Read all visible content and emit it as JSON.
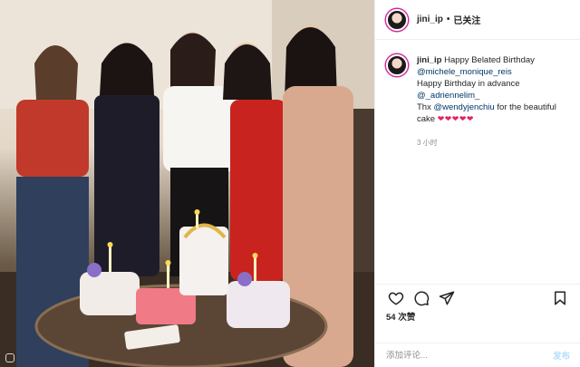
{
  "post": {
    "username": "jini_ip",
    "separator": "•",
    "follow_label": "已关注",
    "caption": {
      "username": "jini_ip",
      "text1": "Happy Belated Birthday",
      "mention1": "@michele_monique_reis",
      "text2": "Happy Birthday in advance",
      "mention2": "@_adriennelim_",
      "text3": "Thx",
      "mention3": "@wendyjenchiu",
      "text4": "for the beautiful cake",
      "hearts": "❤❤❤❤❤"
    },
    "time": "3 小时",
    "likes": "54 次赞",
    "comment_placeholder": "添加评论...",
    "post_label": "发布"
  },
  "icons": {
    "like": "heart-icon",
    "comment": "comment-icon",
    "share": "share-icon",
    "save": "bookmark-icon"
  },
  "colors": {
    "link": "#00376b",
    "post_button": "#b2dffc",
    "muted": "#8e8e8e",
    "heart": "#e0245e"
  }
}
